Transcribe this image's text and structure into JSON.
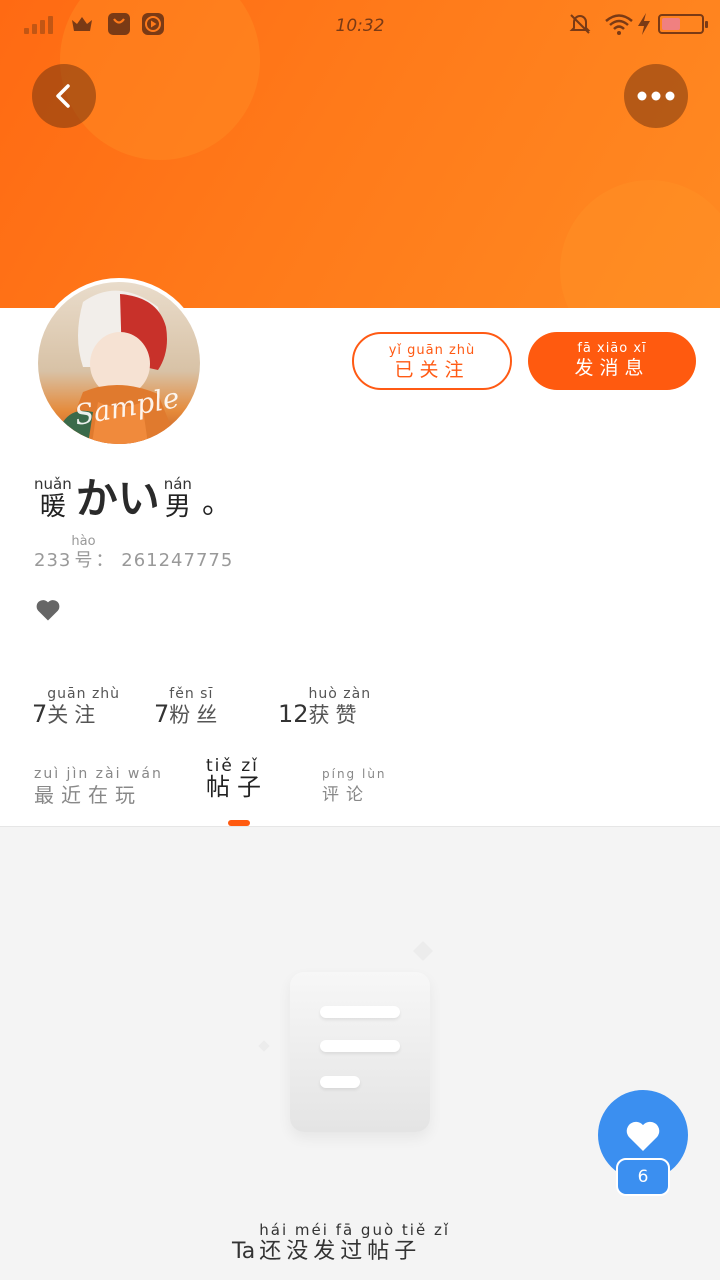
{
  "status_bar": {
    "time": "10:32",
    "icons": [
      "signal-icon",
      "crown-icon",
      "bag-icon",
      "play-icon",
      "mute-bell-icon",
      "wifi-icon",
      "charging-icon",
      "battery-icon"
    ]
  },
  "header": {
    "back_icon": "chevron-left-icon",
    "more_icon": "more-dots-icon",
    "accent": "#ff6a13"
  },
  "profile": {
    "avatar_watermark": "Sample",
    "buttons": {
      "followed": {
        "pinyin": "yǐ guān zhù",
        "text": "已关注"
      },
      "message": {
        "pinyin": "fā xiāo xī",
        "text": "发消息"
      }
    },
    "name": {
      "prefix_pinyin": "nuǎn",
      "prefix": "暖",
      "main": "かい",
      "suffix_pinyin": "nán",
      "suffix": "男",
      "tail": "。"
    },
    "id": {
      "prefix": "233",
      "hao_pinyin": "hào",
      "hao": "号",
      "value": "：  261247775"
    },
    "stats": [
      {
        "num": "7",
        "pinyin": "guān zhù",
        "label": "关注"
      },
      {
        "num": "7",
        "pinyin": "fěn sī",
        "label": "粉丝"
      },
      {
        "num": "12",
        "pinyin": "huò zàn",
        "label": "获赞"
      }
    ],
    "tabs": [
      {
        "pinyin": "zuì jìn zài wán",
        "label": "最近在玩",
        "active": false
      },
      {
        "pinyin": "tiě zǐ",
        "label": "帖子",
        "active": true
      },
      {
        "pinyin": "píng lùn",
        "label": "评论",
        "active": false
      }
    ]
  },
  "empty_state": {
    "lead": "Ta",
    "pinyin": "hái méi fā guò tiě zǐ",
    "text": "还没发过帖子"
  },
  "fab": {
    "icon": "heart-icon",
    "count": "6",
    "color": "#3b8ff0"
  }
}
